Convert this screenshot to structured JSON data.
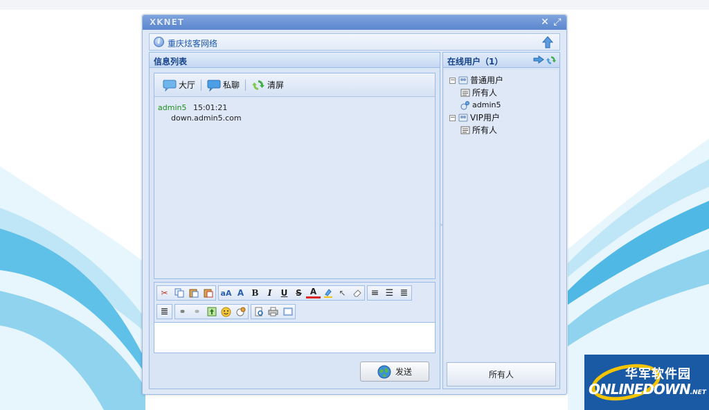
{
  "window": {
    "logo": "XKNET"
  },
  "infobar": {
    "text": "重庆炫客网络"
  },
  "left_panel": {
    "title": "信息列表",
    "tabs": [
      {
        "label": "大厅",
        "icon": "chat-bubble-icon"
      },
      {
        "label": "私聊",
        "icon": "chat-bubble-icon"
      },
      {
        "label": "清屏",
        "icon": "refresh-icon"
      }
    ],
    "messages": [
      {
        "user": "admin5",
        "time": "15:01:21",
        "body": "down.admin5.com"
      }
    ],
    "send_label": "发送"
  },
  "right_panel": {
    "title": "在线用户（1）",
    "tree": [
      {
        "label": "普通用户",
        "children": [
          {
            "label": "所有人",
            "icon": "list-icon"
          },
          {
            "label": "admin5",
            "icon": "user-icon"
          }
        ]
      },
      {
        "label": "VIP用户",
        "children": [
          {
            "label": "所有人",
            "icon": "list-icon"
          }
        ]
      }
    ],
    "target_button": "所有人"
  },
  "watermark": {
    "cn": "华军软件园",
    "en": "ONLINEDOWN",
    "suffix": ".NET"
  }
}
